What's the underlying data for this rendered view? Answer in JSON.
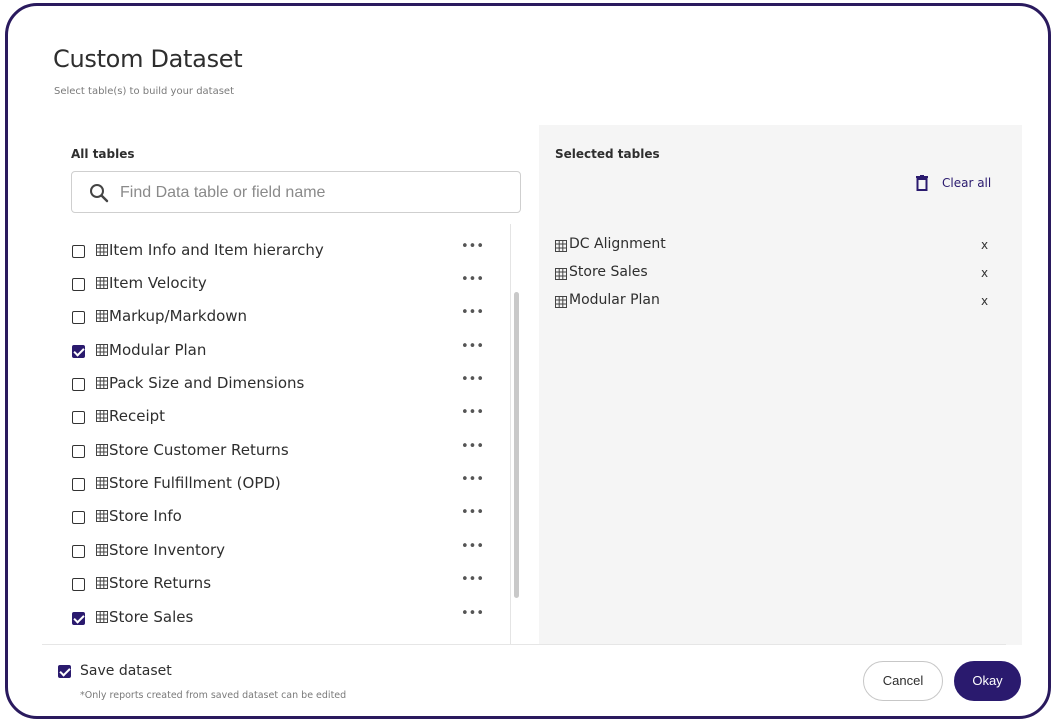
{
  "dialog": {
    "title": "Custom Dataset",
    "subtitle": "Select table(s) to build your dataset"
  },
  "left": {
    "label": "All tables",
    "search": {
      "placeholder": "Find Data table or field name",
      "value": ""
    },
    "more_glyph": "•••",
    "items": [
      {
        "label": "Item Info and Item hierarchy",
        "checked": false
      },
      {
        "label": "Item Velocity",
        "checked": false
      },
      {
        "label": "Markup/Markdown",
        "checked": false
      },
      {
        "label": "Modular Plan",
        "checked": true
      },
      {
        "label": "Pack Size and Dimensions",
        "checked": false
      },
      {
        "label": "Receipt",
        "checked": false
      },
      {
        "label": "Store Customer Returns",
        "checked": false
      },
      {
        "label": "Store Fulfillment (OPD)",
        "checked": false
      },
      {
        "label": "Store Info",
        "checked": false
      },
      {
        "label": "Store Inventory",
        "checked": false
      },
      {
        "label": "Store Returns",
        "checked": false
      },
      {
        "label": "Store Sales",
        "checked": true
      }
    ]
  },
  "right": {
    "label": "Selected tables",
    "clear_all": "Clear all",
    "remove_glyph": "x",
    "items": [
      {
        "label": "DC Alignment"
      },
      {
        "label": "Store Sales"
      },
      {
        "label": "Modular Plan"
      }
    ]
  },
  "footer": {
    "save_label": "Save dataset",
    "save_checked": true,
    "save_note": "*Only reports created from saved dataset can be edited",
    "cancel_label": "Cancel",
    "ok_label": "Okay"
  },
  "colors": {
    "accent": "#2a1a6e",
    "border": "#2a1a5e",
    "panel": "#f5f5f5"
  }
}
